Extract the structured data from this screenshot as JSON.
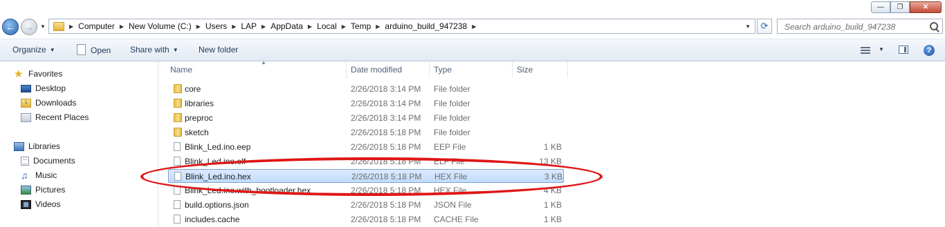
{
  "window": {
    "buttons": {
      "minimize": "—",
      "maximize": "❐",
      "close": "✕"
    }
  },
  "address_bar": {
    "path": [
      "Computer",
      "New Volume (C:)",
      "Users",
      "LAP",
      "AppData",
      "Local",
      "Temp",
      "arduino_build_947238"
    ],
    "back_glyph": "←",
    "forward_glyph": "→",
    "refresh_glyph": "⟳"
  },
  "search": {
    "placeholder": "Search arduino_build_947238"
  },
  "toolbar": {
    "organize": "Organize",
    "open": "Open",
    "share_with": "Share with",
    "new_folder": "New folder",
    "help": "?"
  },
  "nav_pane": {
    "favorites": "Favorites",
    "desktop": "Desktop",
    "downloads": "Downloads",
    "recent_places": "Recent Places",
    "libraries": "Libraries",
    "documents": "Documents",
    "music": "Music",
    "pictures": "Pictures",
    "videos": "Videos"
  },
  "columns": {
    "name": "Name",
    "date": "Date modified",
    "type": "Type",
    "size": "Size"
  },
  "files": [
    {
      "name": "core",
      "date": "2/26/2018 3:14 PM",
      "type": "File folder",
      "size": "",
      "kind": "folder"
    },
    {
      "name": "libraries",
      "date": "2/26/2018 3:14 PM",
      "type": "File folder",
      "size": "",
      "kind": "folder"
    },
    {
      "name": "preproc",
      "date": "2/26/2018 3:14 PM",
      "type": "File folder",
      "size": "",
      "kind": "folder"
    },
    {
      "name": "sketch",
      "date": "2/26/2018 5:18 PM",
      "type": "File folder",
      "size": "",
      "kind": "folder"
    },
    {
      "name": "Blink_Led.ino.eep",
      "date": "2/26/2018 5:18 PM",
      "type": "EEP File",
      "size": "1 KB",
      "kind": "file"
    },
    {
      "name": "Blink_Led.ino.elf",
      "date": "2/26/2018 5:18 PM",
      "type": "ELF File",
      "size": "13 KB",
      "kind": "file"
    },
    {
      "name": "Blink_Led.ino.hex",
      "date": "2/26/2018 5:18 PM",
      "type": "HEX File",
      "size": "3 KB",
      "kind": "file",
      "selected": true
    },
    {
      "name": "Blink_Led.ino.with_bootloader.hex",
      "date": "2/26/2018 5:18 PM",
      "type": "HEX File",
      "size": "4 KB",
      "kind": "file"
    },
    {
      "name": "build.options.json",
      "date": "2/26/2018 5:18 PM",
      "type": "JSON File",
      "size": "1 KB",
      "kind": "file"
    },
    {
      "name": "includes.cache",
      "date": "2/26/2018 5:18 PM",
      "type": "CACHE File",
      "size": "1 KB",
      "kind": "file"
    }
  ],
  "colors": {
    "annotation": "#e01616",
    "selection": "#c2dcfd",
    "toolbar_text": "#1e395b"
  }
}
